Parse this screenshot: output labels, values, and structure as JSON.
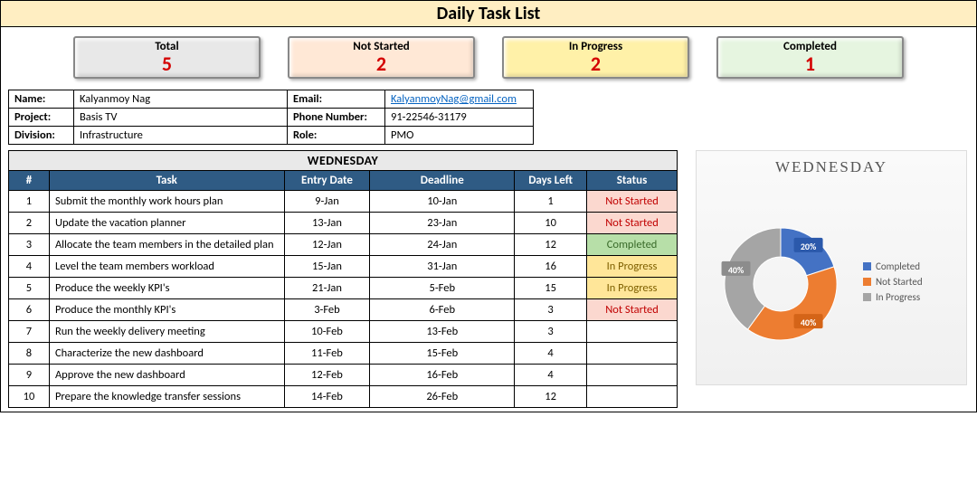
{
  "page_title": "Daily Task List",
  "cards": [
    {
      "key": "total",
      "label": "Total",
      "value": "5",
      "css": "total"
    },
    {
      "key": "notstarted",
      "label": "Not Started",
      "value": "2",
      "css": "notstart"
    },
    {
      "key": "inprogress",
      "label": "In Progress",
      "value": "2",
      "css": "inprog"
    },
    {
      "key": "completed",
      "label": "Completed",
      "value": "1",
      "css": "completed"
    }
  ],
  "info": {
    "name_label": "Name:",
    "name": "Kalyanmoy Nag",
    "project_label": "Project:",
    "project": "Basis TV",
    "division_label": "Division:",
    "division": "Infrastructure",
    "email_label": "Email:",
    "email": "KalyanmoyNag@gmail.com",
    "phone_label": "Phone Number:",
    "phone": "91-22546-31179",
    "role_label": "Role:",
    "role": "PMO"
  },
  "task_table": {
    "day": "WEDNESDAY",
    "headers": {
      "num": "#",
      "task": "Task",
      "entry": "Entry Date",
      "deadline": "Deadline",
      "days_left": "Days Left",
      "status": "Status"
    },
    "rows": [
      {
        "n": "1",
        "task": "Submit the monthly work hours plan",
        "entry": "9-Jan",
        "deadline": "10-Jan",
        "days_left": "1",
        "status": "Not Started",
        "status_class": "st-notstarted"
      },
      {
        "n": "2",
        "task": "Update the vacation planner",
        "entry": "13-Jan",
        "deadline": "23-Jan",
        "days_left": "10",
        "status": "Not Started",
        "status_class": "st-notstarted"
      },
      {
        "n": "3",
        "task": "Allocate the team members in the detailed plan",
        "entry": "12-Jan",
        "deadline": "24-Jan",
        "days_left": "12",
        "status": "Completed",
        "status_class": "st-completed"
      },
      {
        "n": "4",
        "task": "Level the team members workload",
        "entry": "15-Jan",
        "deadline": "31-Jan",
        "days_left": "16",
        "status": "In Progress",
        "status_class": "st-inprogress"
      },
      {
        "n": "5",
        "task": "Produce the weekly KPI's",
        "entry": "21-Jan",
        "deadline": "5-Feb",
        "days_left": "15",
        "status": "In Progress",
        "status_class": "st-inprogress"
      },
      {
        "n": "6",
        "task": "Produce the monthly KPI's",
        "entry": "3-Feb",
        "deadline": "6-Feb",
        "days_left": "3",
        "status": "Not Started",
        "status_class": "st-notstarted"
      },
      {
        "n": "7",
        "task": "Run the weekly delivery meeting",
        "entry": "10-Feb",
        "deadline": "13-Feb",
        "days_left": "3",
        "status": "",
        "status_class": ""
      },
      {
        "n": "8",
        "task": "Characterize the new dashboard",
        "entry": "11-Feb",
        "deadline": "15-Feb",
        "days_left": "4",
        "status": "",
        "status_class": ""
      },
      {
        "n": "9",
        "task": "Approve the new dashboard",
        "entry": "12-Feb",
        "deadline": "16-Feb",
        "days_left": "4",
        "status": "",
        "status_class": ""
      },
      {
        "n": "10",
        "task": "Prepare the knowledge transfer sessions",
        "entry": "14-Feb",
        "deadline": "26-Feb",
        "days_left": "12",
        "status": "",
        "status_class": ""
      }
    ]
  },
  "chart_data": {
    "type": "pie",
    "title": "WEDNESDAY",
    "series": [
      {
        "name": "Completed",
        "value": 20,
        "label": "20%",
        "color": "#4472c4"
      },
      {
        "name": "Not Started",
        "value": 40,
        "label": "40%",
        "color": "#ed7d31"
      },
      {
        "name": "In Progress",
        "value": 40,
        "label": "40%",
        "color": "#a5a5a5"
      }
    ],
    "legend": [
      "Completed",
      "Not Started",
      "In Progress"
    ]
  }
}
